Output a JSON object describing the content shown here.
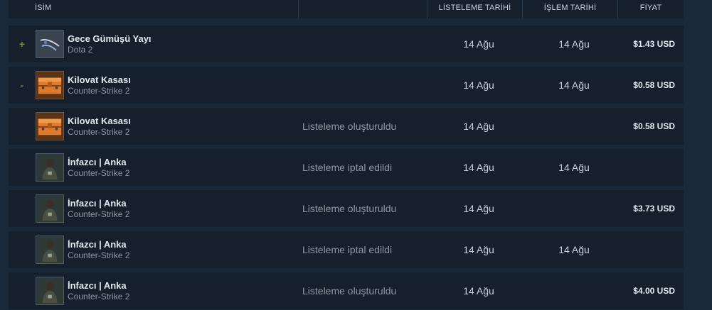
{
  "header": {
    "col_name": "İSİM",
    "col_action": "",
    "col_listed": "LİSTELEME TARİHİ",
    "col_acted": "İŞLEM TARİHİ",
    "col_price": "FİYAT"
  },
  "rows": [
    {
      "gain": "+",
      "name": "Gece Gümüşü Yayı",
      "game": "Dota 2",
      "action": "",
      "listed": "14 Ağu",
      "acted": "14 Ağu",
      "price": "$1.43 USD",
      "thumb": "bow-icon"
    },
    {
      "gain": "-",
      "name": "Kilovat Kasası",
      "game": "Counter-Strike 2",
      "action": "",
      "listed": "14 Ağu",
      "acted": "14 Ağu",
      "price": "$0.58 USD",
      "thumb": "crate-icon"
    },
    {
      "gain": "",
      "name": "Kilovat Kasası",
      "game": "Counter-Strike 2",
      "action": "Listeleme oluşturuldu",
      "listed": "14 Ağu",
      "acted": "",
      "price": "$0.58 USD",
      "thumb": "crate-icon"
    },
    {
      "gain": "",
      "name": "İnfazcı | Anka",
      "game": "Counter-Strike 2",
      "action": "Listeleme iptal edildi",
      "listed": "14 Ağu",
      "acted": "14 Ağu",
      "price": "",
      "thumb": "agent-icon"
    },
    {
      "gain": "",
      "name": "İnfazcı | Anka",
      "game": "Counter-Strike 2",
      "action": "Listeleme oluşturuldu",
      "listed": "14 Ağu",
      "acted": "",
      "price": "$3.73 USD",
      "thumb": "agent-icon"
    },
    {
      "gain": "",
      "name": "İnfazcı | Anka",
      "game": "Counter-Strike 2",
      "action": "Listeleme iptal edildi",
      "listed": "14 Ağu",
      "acted": "14 Ağu",
      "price": "",
      "thumb": "agent-icon"
    },
    {
      "gain": "",
      "name": "İnfazcı | Anka",
      "game": "Counter-Strike 2",
      "action": "Listeleme oluşturuldu",
      "listed": "14 Ağu",
      "acted": "",
      "price": "$4.00 USD",
      "thumb": "agent-icon"
    }
  ],
  "colors": {
    "background": "#1b2838",
    "row_background": "#16202d",
    "gain_color": "#6b8f3f",
    "muted_text": "#8f98a0"
  }
}
